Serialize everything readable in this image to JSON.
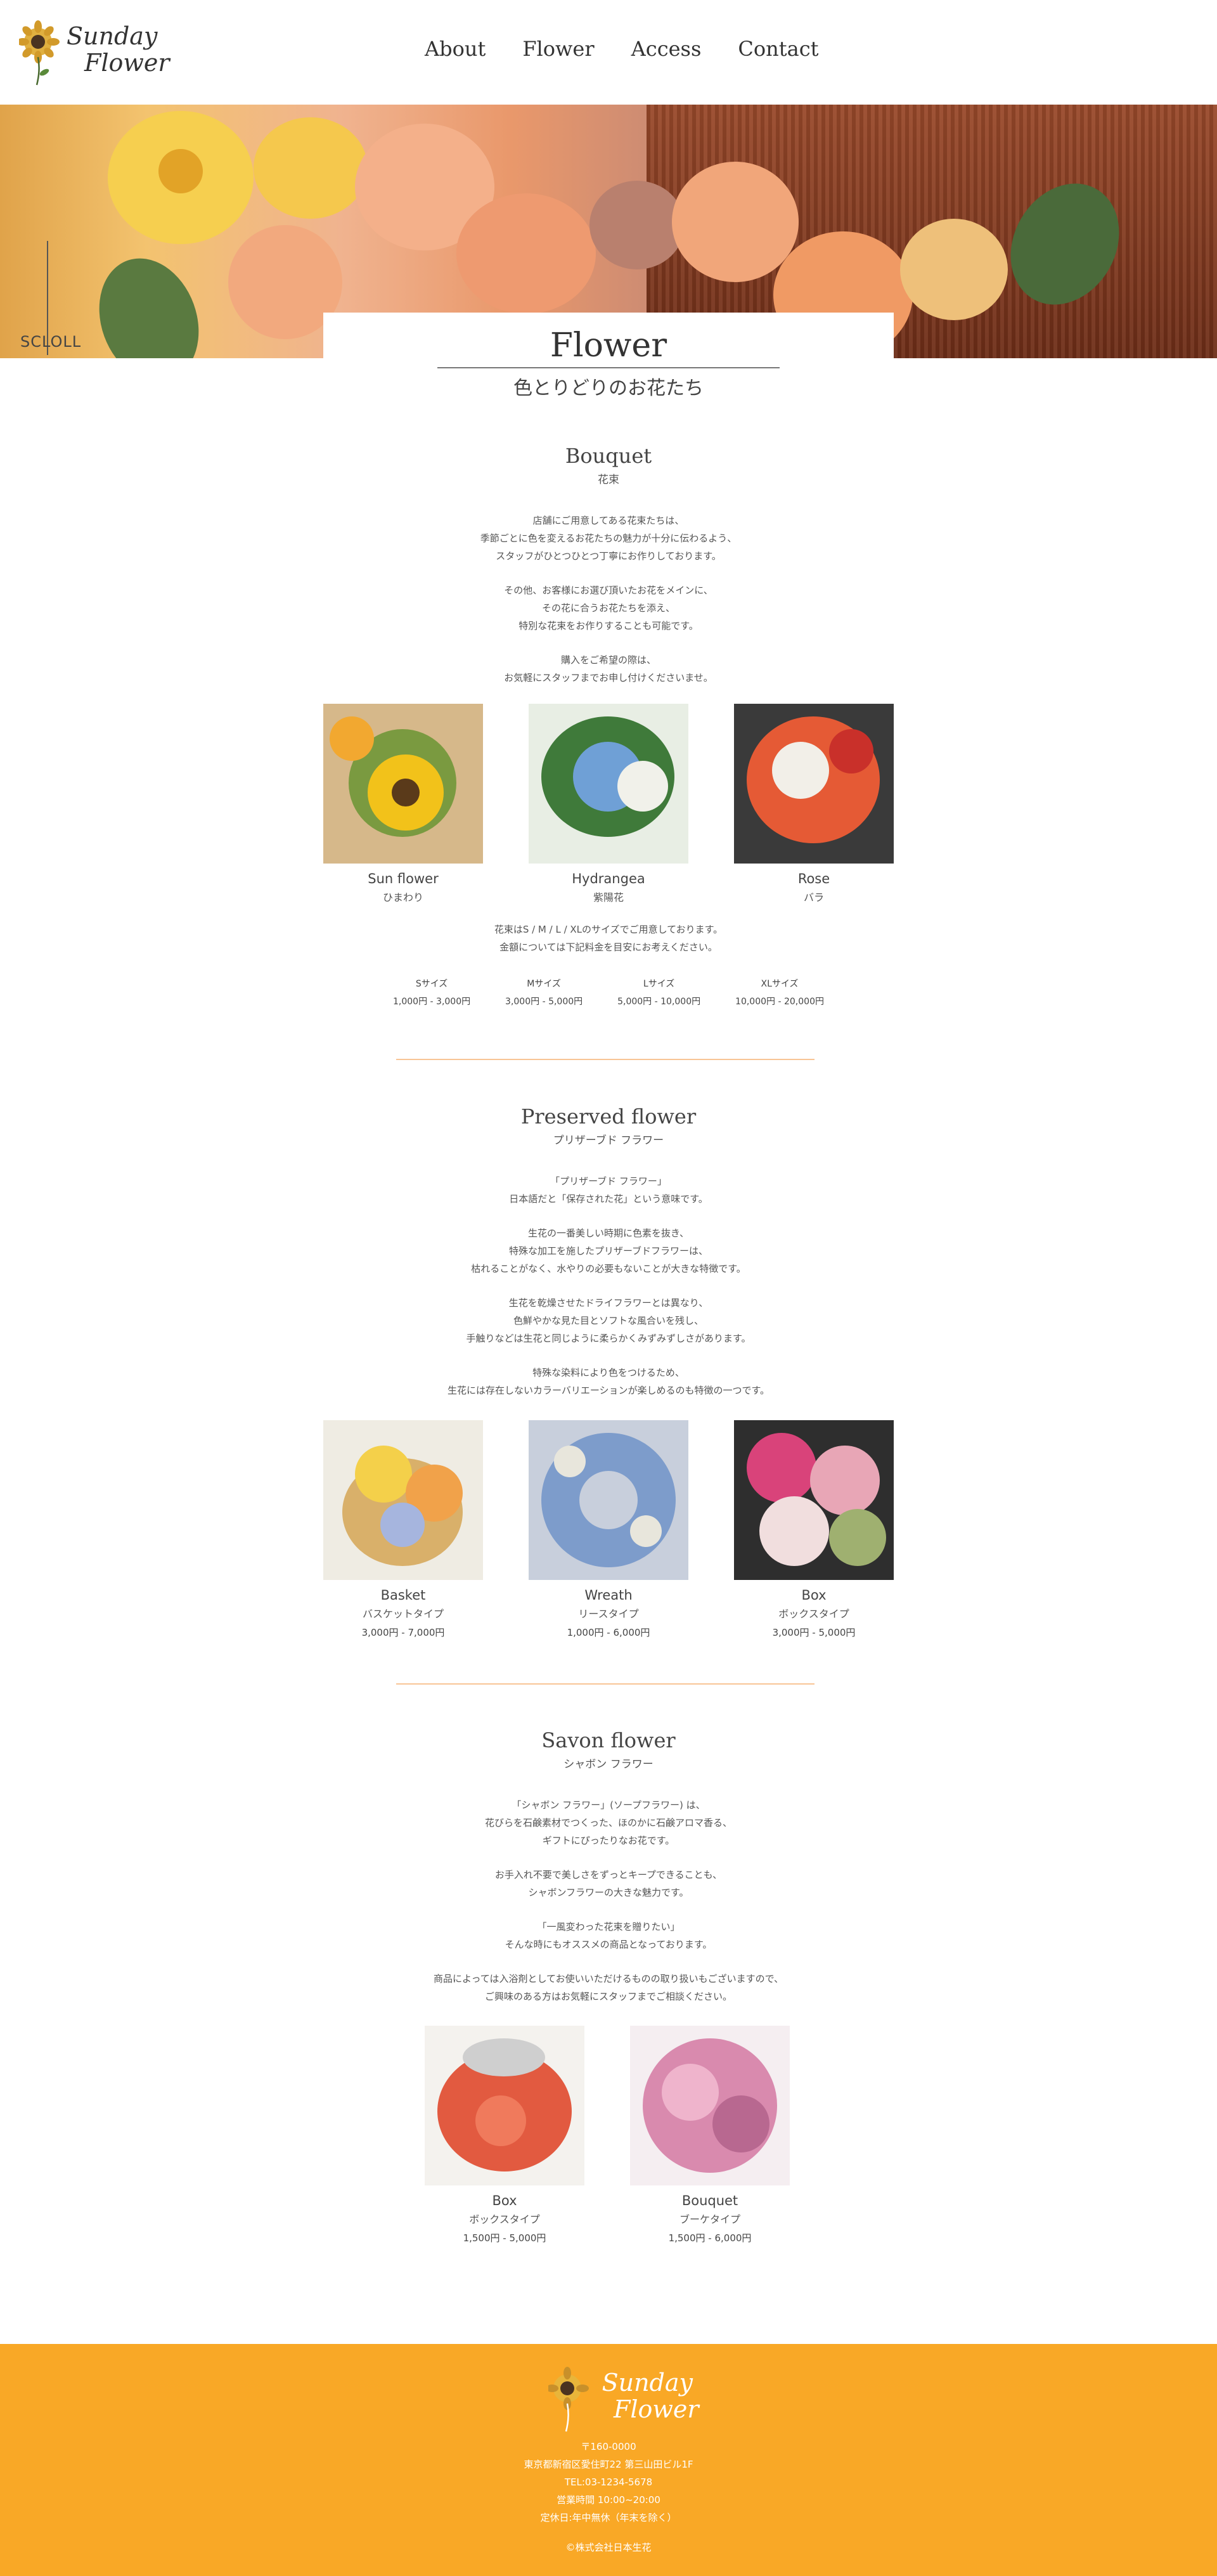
{
  "header": {
    "logo_top": "Sunday",
    "logo_bottom": "Flower",
    "nav": [
      "About",
      "Flower",
      "Access",
      "Contact"
    ]
  },
  "hero": {
    "scroll_label": "SCLOLL"
  },
  "title_card": {
    "title": "Flower",
    "subtitle": "色とりどりのお花たち"
  },
  "bouquet": {
    "title": "Bouquet",
    "subtitle": "花束",
    "paragraphs": [
      [
        "店舗にご用意してある花束たちは、",
        "季節ごとに色を変えるお花たちの魅力が十分に伝わるよう、",
        "スタッフがひとつひとつ丁寧にお作りしております。"
      ],
      [
        "その他、お客様にお選び頂いたお花をメインに、",
        "その花に合うお花たちを添え、",
        "特別な花束をお作りすることも可能です。"
      ],
      [
        "購入をご希望の際は、",
        "お気軽にスタッフまでお申し付けくださいませ。"
      ]
    ],
    "items": [
      {
        "name": "Sun flower",
        "jp": "ひまわり"
      },
      {
        "name": "Hydrangea",
        "jp": "紫陽花"
      },
      {
        "name": "Rose",
        "jp": "バラ"
      }
    ],
    "size_note": [
      "花束はS / M / L / XLのサイズでご用意しております。",
      "金額については下記料金を目安にお考えください。"
    ],
    "sizes": [
      {
        "label": "Sサイズ",
        "price": "1,000円 - 3,000円"
      },
      {
        "label": "Mサイズ",
        "price": "3,000円 - 5,000円"
      },
      {
        "label": "Lサイズ",
        "price": "5,000円 - 10,000円"
      },
      {
        "label": "XLサイズ",
        "price": "10,000円 - 20,000円"
      }
    ]
  },
  "preserved": {
    "title": "Preserved flower",
    "subtitle": "プリザーブド フラワー",
    "paragraphs": [
      [
        "「プリザーブド フラワー」",
        "日本語だと「保存された花」という意味です。"
      ],
      [
        "生花の一番美しい時期に色素を抜き、",
        "特殊な加工を施したプリザーブドフラワーは、",
        "枯れることがなく、水やりの必要もないことが大きな特徴です。"
      ],
      [
        "生花を乾燥させたドライフラワーとは異なり、",
        "色鮮やかな見た目とソフトな風合いを残し、",
        "手触りなどは生花と同じように柔らかくみずみずしさがあります。"
      ],
      [
        "特殊な染料により色をつけるため、",
        "生花には存在しないカラーバリエーションが楽しめるのも特徴の一つです。"
      ]
    ],
    "items": [
      {
        "name": "Basket",
        "jp": "バスケットタイプ",
        "price": "3,000円 - 7,000円"
      },
      {
        "name": "Wreath",
        "jp": "リースタイプ",
        "price": "1,000円 - 6,000円"
      },
      {
        "name": "Box",
        "jp": "ボックスタイプ",
        "price": "3,000円 - 5,000円"
      }
    ]
  },
  "savon": {
    "title": "Savon flower",
    "subtitle": "シャボン フラワー",
    "paragraphs": [
      [
        "「シャボン フラワー」(ソープフラワー) は、",
        "花びらを石鹸素材でつくった、ほのかに石鹸アロマ香る、",
        "ギフトにぴったりなお花です。"
      ],
      [
        "お手入れ不要で美しさをずっとキープできることも、",
        "シャボンフラワーの大きな魅力です。"
      ],
      [
        "「一風変わった花束を贈りたい」",
        "そんな時にもオススメの商品となっております。"
      ],
      [
        "商品によっては入浴剤としてお使いいただけるものの取り扱いもございますので、",
        "ご興味のある方はお気軽にスタッフまでご相談ください。"
      ]
    ],
    "items": [
      {
        "name": "Box",
        "jp": "ボックスタイプ",
        "price": "1,500円 - 5,000円"
      },
      {
        "name": "Bouquet",
        "jp": "ブーケタイプ",
        "price": "1,500円 - 6,000円"
      }
    ]
  },
  "footer": {
    "logo_top": "Sunday",
    "logo_bottom": "Flower",
    "info": [
      "〒160-0000",
      "東京都新宿区愛住町22 第三山田ビル1F",
      "TEL:03-1234-5678",
      "営業時間 10:00~20:00",
      "定休日:年中無休（年末を除く）"
    ],
    "copyright": "©株式会社日本生花"
  },
  "colors": {
    "accent": "#f9a826",
    "divider": "#f8c596"
  }
}
